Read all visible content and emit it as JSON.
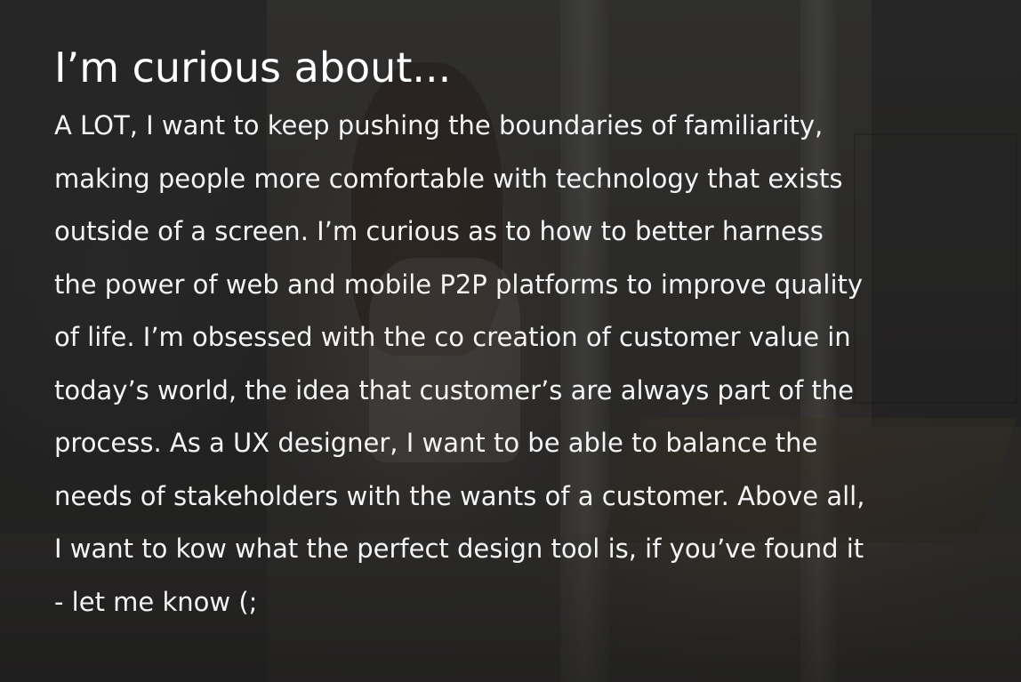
{
  "heading": "I’m curious about...",
  "body_lines": [
    "A LOT, I want to keep pushing the boundaries of familiarity,",
    "making people more comfortable with technology that exists",
    "outside of a screen. I’m curious as to how to better harness",
    "the power of web and mobile P2P platforms to improve quality",
    "of life. I’m obsessed with the co creation of customer value in",
    "today’s world, the idea that customer’s are always part of the",
    "process. As a UX designer, I want to be able to balance the",
    "needs of stakeholders with the wants of a customer. Above all,",
    "I want to kow what the perfect design tool is, if you’ve found it",
    "- let me know (;"
  ],
  "colors": {
    "text": "#ffffff",
    "overlay": "#2e2d2b"
  }
}
